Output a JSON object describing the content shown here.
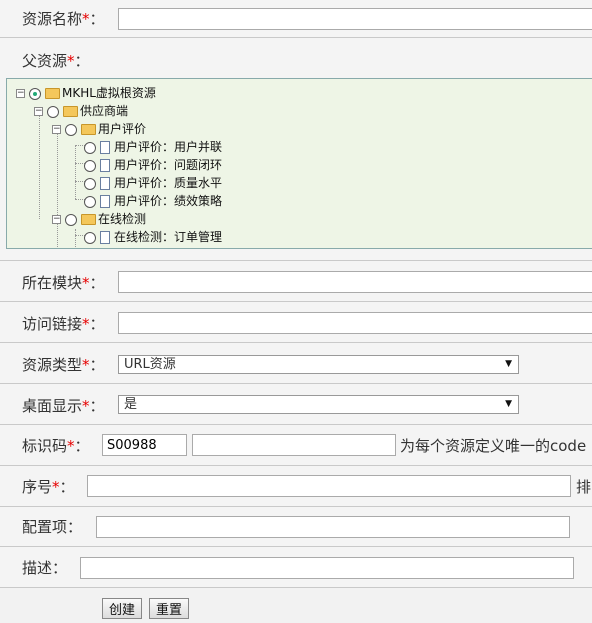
{
  "required_mark": "*",
  "colon": "：",
  "fields": {
    "resource_name": {
      "label": "资源名称",
      "value": ""
    },
    "parent_resource": {
      "label": "父资源"
    },
    "module": {
      "label": "所在模块",
      "value": ""
    },
    "access_link": {
      "label": "访问链接",
      "value": ""
    },
    "resource_type": {
      "label": "资源类型",
      "selected": "URL资源"
    },
    "desktop_display": {
      "label": "桌面显示",
      "selected": "是"
    },
    "identifier": {
      "label": "标识码",
      "prefix": "S00988",
      "value": "",
      "hint": "为每个资源定义唯一的code"
    },
    "order": {
      "label": "序号",
      "value": "",
      "hint": "排"
    },
    "config": {
      "label": "配置项",
      "value": ""
    },
    "description": {
      "label": "描述",
      "value": ""
    }
  },
  "tree": {
    "root": "MKHL虚拟根资源",
    "n1": "供应商端",
    "n2": "用户评价",
    "n2a": "用户评价：用户并联",
    "n2b": "用户评价：问题闭环",
    "n2c": "用户评价：质量水平",
    "n2d": "用户评价：绩效策略",
    "n3": "在线检测",
    "n3a": "在线检测：订单管理"
  },
  "buttons": {
    "create": "创建",
    "reset": "重置"
  }
}
